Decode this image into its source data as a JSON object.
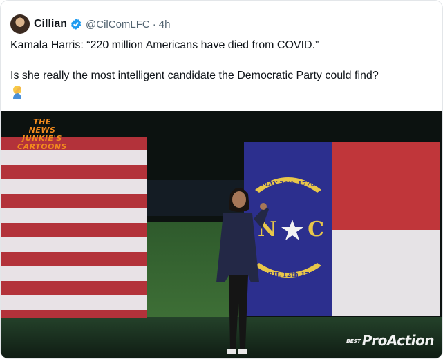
{
  "tweet": {
    "author_name": "Cillian",
    "handle": "@CilComLFC",
    "separator": "·",
    "timestamp": "4h",
    "line1": "Kamala Harris: “220 million Americans have died from COVID.”",
    "line2": "Is she really the most intelligent candidate the Democratic Party could find?",
    "emoji": "person-facepalming-emoji"
  },
  "media": {
    "watermark_top": [
      "THE",
      "NEWS JUNKIE'S",
      "CARTOONS"
    ],
    "watermark_bottom": "ProAction",
    "watermark_bottom_prefix": "BEST",
    "nc_flag": {
      "top_banner": "MAY 20th 1775",
      "bottom_banner": "APRIL 12th 1776",
      "letter_left": "N",
      "letter_right": "C"
    }
  },
  "colors": {
    "verified": "#1d9bf0",
    "text_secondary": "#536471",
    "nc_blue": "#2c2f8e",
    "flag_red": "#c0363a"
  }
}
